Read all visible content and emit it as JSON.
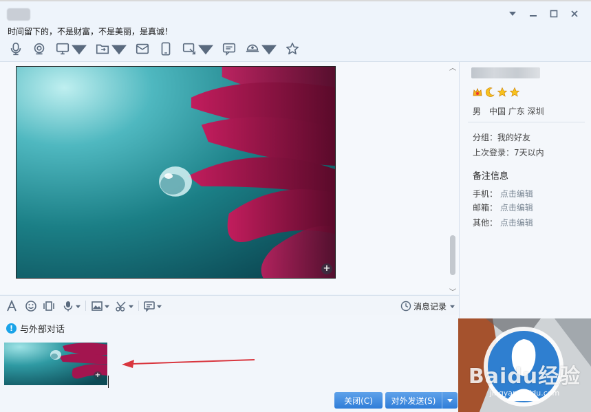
{
  "header": {
    "signature": "时间留下的，不是财富，不是美丽，是真诚！"
  },
  "toolbar": {
    "items": [
      "microphone-icon",
      "video-call-icon",
      "screen-share-icon",
      "file-transfer-icon",
      "email-icon",
      "mobile-icon",
      "remote-assist-icon",
      "message-board-icon",
      "apps-icon",
      "favorite-star-icon"
    ]
  },
  "input_toolbar": {
    "history_label": "消息记录"
  },
  "notice": {
    "text": "与外部对话"
  },
  "buttons": {
    "close_label": "关闭(C)",
    "send_label": "对外发送(S)"
  },
  "profile": {
    "gender": "男",
    "location": "中国 广东 深圳",
    "group_label": "分组：我的好友",
    "last_login_label": "上次登录：7天以内",
    "notes_title": "备注信息",
    "phone_label": "手机：",
    "email_label": "邮箱：",
    "other_label": "其他：",
    "edit_link": "点击编辑"
  },
  "watermark": {
    "logo": "Baidu经验",
    "url": "jingyan.baidu.com"
  },
  "colors": {
    "accent": "#3d8ae0",
    "panel_bg": "#f4f7fb",
    "petal": "#a0164f",
    "teal": "#1b7f86"
  }
}
